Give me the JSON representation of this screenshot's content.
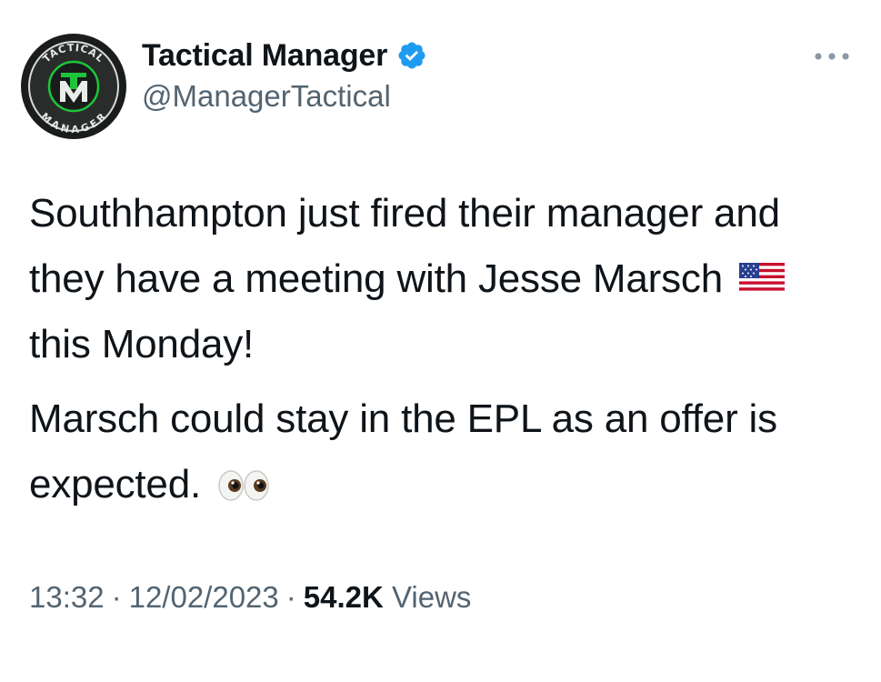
{
  "author": {
    "display_name": "Tactical Manager",
    "handle": "@ManagerTactical",
    "verified": true,
    "avatar_top_text": "TACTICAL",
    "avatar_bottom_text": "MANAGER"
  },
  "tweet": {
    "line1_before_flag": "Southhampton just fired their manager and they have a meeting with Jesse Marsch",
    "line1_after_flag": "this Monday!",
    "line2": "Marsch could stay in the EPL as an offer is expected."
  },
  "meta": {
    "time": "13:32",
    "date": "12/02/2023",
    "separator": "·",
    "views_count": "54.2K",
    "views_label": "Views"
  },
  "colors": {
    "text": "#0f1419",
    "secondary": "#536471",
    "verified_blue": "#1d9bf0",
    "logo_green": "#1ec43a"
  },
  "icons": {
    "verified": "verified-badge-icon",
    "more": "more-horizontal-icon",
    "flag": "us-flag-emoji",
    "eyes": "eyes-emoji"
  }
}
